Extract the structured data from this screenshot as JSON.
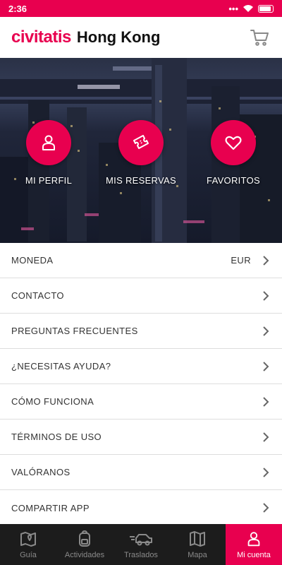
{
  "status_bar": {
    "time": "2:36"
  },
  "header": {
    "brand": "civitatis",
    "city": "Hong Kong"
  },
  "hero": {
    "buttons": [
      {
        "label": "MI PERFIL",
        "icon": "person-icon"
      },
      {
        "label": "MIS RESERVAS",
        "icon": "ticket-icon"
      },
      {
        "label": "FAVORITOS",
        "icon": "heart-icon"
      }
    ]
  },
  "menu": {
    "items": [
      {
        "label": "MONEDA",
        "value": "EUR"
      },
      {
        "label": "CONTACTO"
      },
      {
        "label": "PREGUNTAS FRECUENTES"
      },
      {
        "label": "¿NECESITAS AYUDA?"
      },
      {
        "label": "CÓMO FUNCIONA"
      },
      {
        "label": "TÉRMINOS DE USO"
      },
      {
        "label": "VALÓRANOS"
      },
      {
        "label": "COMPARTIR APP"
      }
    ]
  },
  "bottom_nav": {
    "items": [
      {
        "label": "Guía",
        "icon": "map-book-icon"
      },
      {
        "label": "Actividades",
        "icon": "backpack-icon"
      },
      {
        "label": "Traslados",
        "icon": "car-icon"
      },
      {
        "label": "Mapa",
        "icon": "map-icon"
      },
      {
        "label": "Mi cuenta",
        "icon": "person-icon",
        "active": true
      }
    ]
  },
  "colors": {
    "brand": "#e8004f",
    "nav_bg": "#1c1c1c",
    "divider": "#dddddd"
  }
}
